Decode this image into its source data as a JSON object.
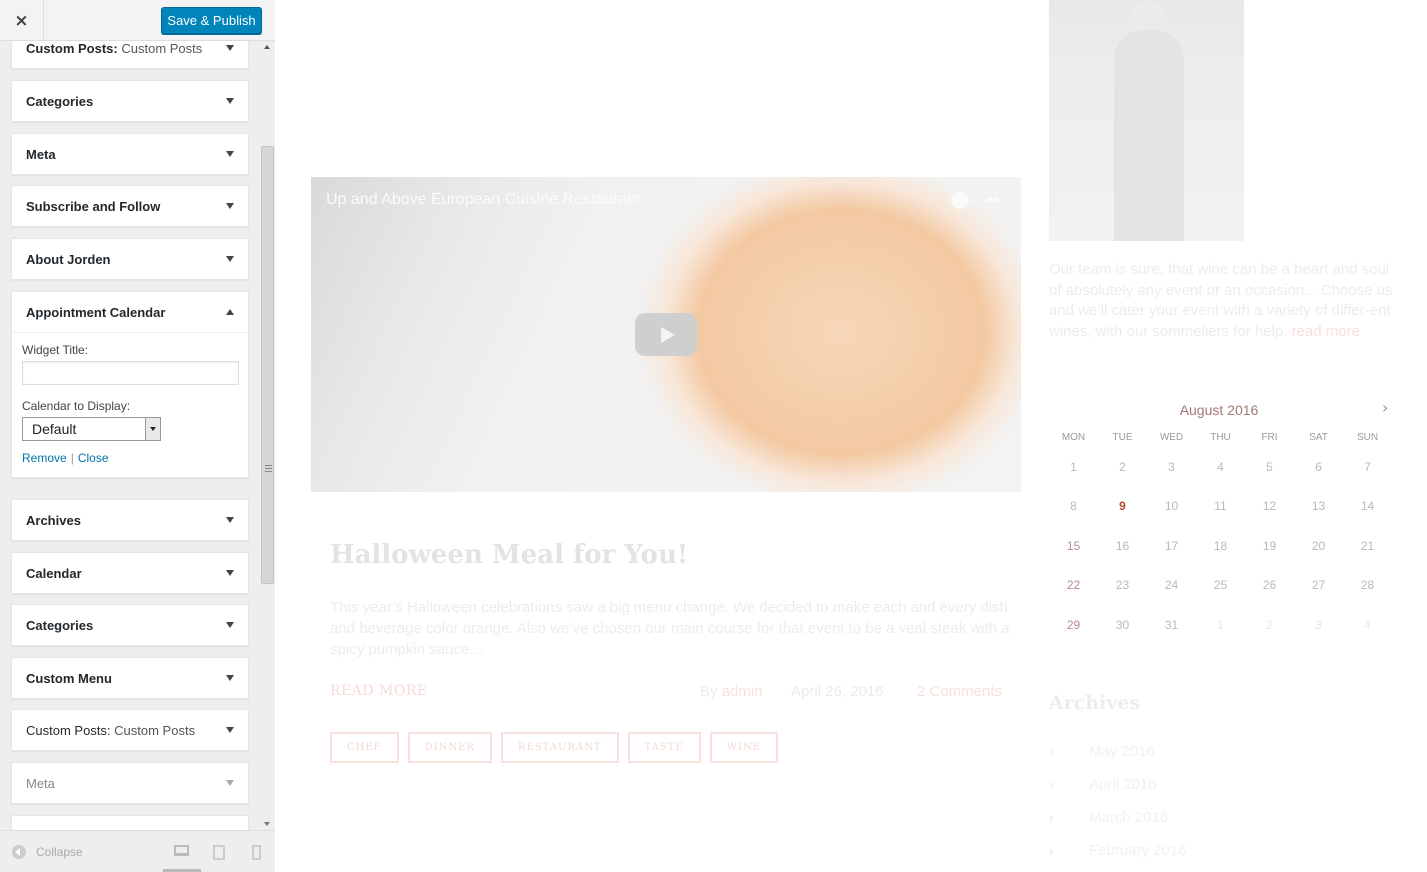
{
  "header": {
    "close_label": "×",
    "publish_label": "Save & Publish"
  },
  "widgets": [
    {
      "title": "Custom Posts:",
      "subtitle": "Custom Posts"
    },
    {
      "title": "Categories"
    },
    {
      "title": "Meta"
    },
    {
      "title": "Subscribe and Follow"
    },
    {
      "title": "About Jorden"
    },
    {
      "title": "Appointment Calendar",
      "expanded": true
    },
    {
      "title": "Archives"
    },
    {
      "title": "Calendar"
    },
    {
      "title": "Categories"
    },
    {
      "title": "Custom Menu"
    },
    {
      "title": "Custom Posts:",
      "subtitle": "Custom Posts"
    },
    {
      "title": "Meta"
    }
  ],
  "appointment_form": {
    "widget_title_label": "Widget Title:",
    "widget_title_value": "",
    "calendar_label": "Calendar to Display:",
    "calendar_value": "Default",
    "remove_label": "Remove",
    "separator": "|",
    "close_label": "Close"
  },
  "footer": {
    "collapse_label": "Collapse",
    "active_device": "desktop"
  },
  "preview": {
    "video_title": "Up and Above European Cuisine Restaurant",
    "post": {
      "title": "Halloween Meal for You!",
      "excerpt": "This year’s Halloween celebrations saw a big menu change. We decided to make each and every dish and beverage color orange. Also we’ve chosen our main course for that event to be a veal steak with a spicy pumpkin sauce…",
      "read_more": "READ MORE",
      "by_label": "By",
      "author": "admin",
      "date": "April 26, 2016",
      "comments": "2 Comments",
      "tags": [
        "CHEF",
        "DINNER",
        "RESTAURANT",
        "TASTE",
        "WINE"
      ]
    },
    "about": {
      "text": "Our team is sure, that wine can be a heart and soul of absolutely any event or an occasion... Choose us and we’ll cater your event with a variety of differ-ent wines, with our sommeliers for help.",
      "read_more": "read more"
    },
    "calendar": {
      "month": "August 2016",
      "next": "›",
      "weekdays": [
        "MON",
        "TUE",
        "WED",
        "THU",
        "FRI",
        "SAT",
        "SUN"
      ],
      "days": [
        "1",
        "2",
        "3",
        "4",
        "5",
        "6",
        "7",
        "8",
        "9",
        "10",
        "11",
        "12",
        "13",
        "14",
        "15",
        "16",
        "17",
        "18",
        "19",
        "20",
        "21",
        "22",
        "23",
        "24",
        "25",
        "26",
        "27",
        "28",
        "29",
        "30",
        "31",
        "1",
        "2",
        "3",
        "4"
      ],
      "highlighted": [
        "9"
      ],
      "linked": [
        "15",
        "22",
        "29"
      ]
    },
    "archives": {
      "title": "Archives",
      "items": [
        "May 2016",
        "April 2016",
        "March 2016",
        "February 2016"
      ]
    }
  },
  "colors": {
    "publish_button": "#0085ba",
    "link": "#0073aa",
    "calendar_accent": "#b0493a"
  }
}
